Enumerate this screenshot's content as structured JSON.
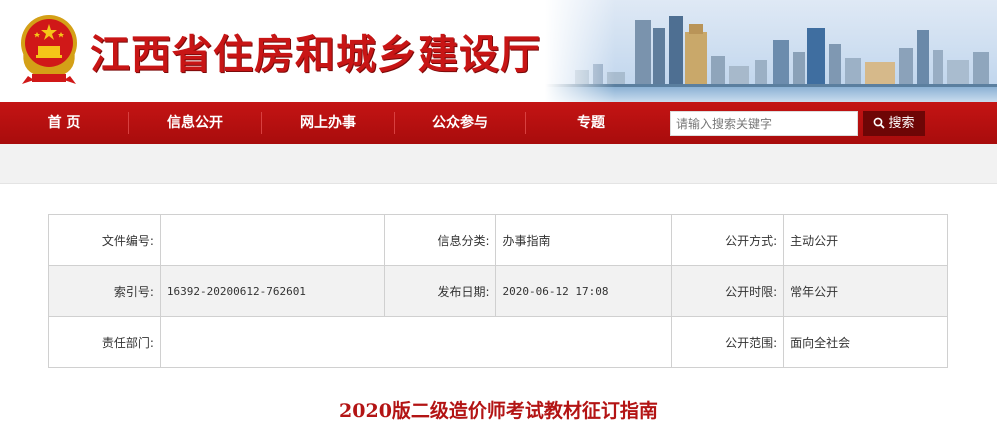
{
  "site": {
    "title": "江西省住房和城乡建设厅"
  },
  "nav": {
    "items": [
      "首 页",
      "信息公开",
      "网上办事",
      "公众参与",
      "专题"
    ]
  },
  "search": {
    "placeholder": "请输入搜索关键字",
    "button_label": "搜索"
  },
  "meta": {
    "rows": [
      [
        {
          "label": "文件编号:",
          "value": ""
        },
        {
          "label": "信息分类:",
          "value": "办事指南"
        },
        {
          "label": "公开方式:",
          "value": "主动公开"
        }
      ],
      [
        {
          "label": "索引号:",
          "value": "16392-20200612-762601"
        },
        {
          "label": "发布日期:",
          "value": "2020-06-12 17:08"
        },
        {
          "label": "公开时限:",
          "value": "常年公开"
        }
      ],
      [
        {
          "label": "责任部门:",
          "value": ""
        },
        {
          "label": "",
          "value": ""
        },
        {
          "label": "公开范围:",
          "value": "面向全社会"
        }
      ]
    ]
  },
  "article": {
    "title": "2020版二级造价师考试教材征订指南"
  },
  "colors": {
    "brand_red": "#c41414",
    "dark_red": "#6e0606",
    "title_red": "#b31414"
  }
}
